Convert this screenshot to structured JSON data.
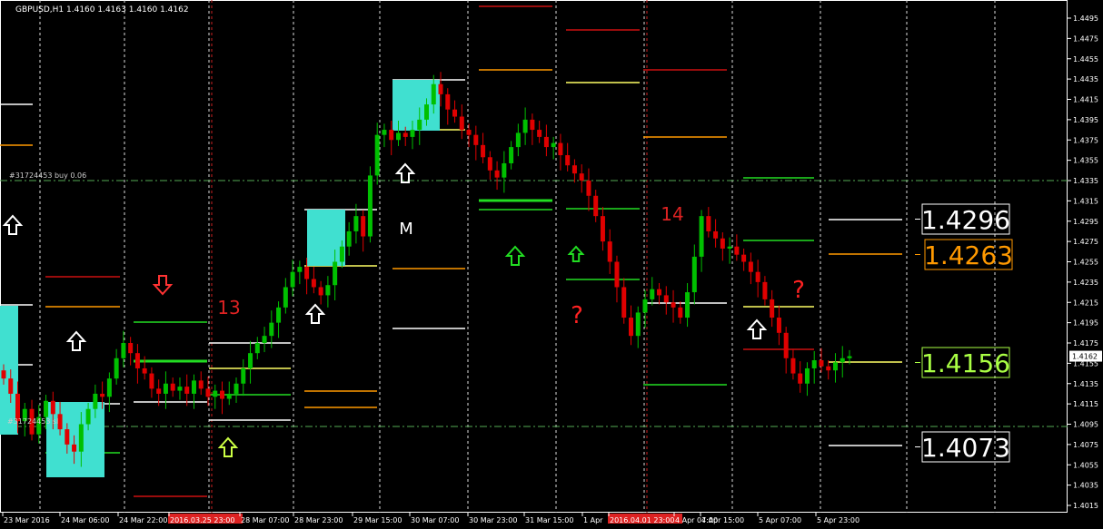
{
  "header": {
    "symbol_line": "GBPUSD,H1  1.4160 1.4163 1.4160 1.4162",
    "order_label": "#31724453 buy 0.06",
    "order_label_2": "#31724453 sl"
  },
  "colors": {
    "background": "#000000",
    "bull": "#00c000",
    "bear": "#e00000",
    "box": "#40e0d0",
    "white": "#ffffff",
    "orange": "#ff9900",
    "yellow": "#ffff66",
    "green_line": "#22dd22",
    "red_line": "#cc1111",
    "grid": "#dddddd",
    "dashdot": "#55aa55"
  },
  "chart_data": {
    "type": "candlestick",
    "symbol": "GBPUSD",
    "timeframe": "H1",
    "current_price": "1.4162",
    "ylim": [
      1.4012,
      1.4505
    ],
    "y_ticks": [
      "1.4495",
      "1.4475",
      "1.4455",
      "1.4435",
      "1.4415",
      "1.4395",
      "1.4375",
      "1.4355",
      "1.4335",
      "1.4315",
      "1.4295",
      "1.4275",
      "1.4255",
      "1.4235",
      "1.4215",
      "1.4195",
      "1.4175",
      "1.4155",
      "1.4135",
      "1.4115",
      "1.4095",
      "1.4075",
      "1.4055",
      "1.4035",
      "1.4015"
    ],
    "x_labels": [
      "23 Mar 2016",
      "24 Mar 06:00",
      "24 Mar 22:00",
      "2016.03.25 23:00",
      "28 Mar 07:00",
      "28 Mar 23:00",
      "29 Mar 15:00",
      "30 Mar 07:00",
      "30 Mar 23:00",
      "31 Mar 15:00",
      "1 Apr",
      "2016.04.01 23:00",
      "4 Apr 07:00",
      "4 Apr 15:00",
      "5 Apr 07:00",
      "5 Apr 23:00"
    ],
    "price_labels": [
      {
        "text": "1.4296",
        "color": "#ffffff"
      },
      {
        "text": "1.4263",
        "color": "#ff9900"
      },
      {
        "text": "1.4156",
        "color": "#aaff44"
      },
      {
        "text": "1.4073",
        "color": "#ffffff"
      }
    ],
    "annotations": [
      {
        "text": "13",
        "color": "#dd2222"
      },
      {
        "text": "14",
        "color": "#dd2222"
      },
      {
        "text": "M",
        "color": "#ffffff"
      },
      {
        "text": "?",
        "color": "#ff2222"
      },
      {
        "text": "?",
        "color": "#ff2222"
      }
    ],
    "closes": [
      1.414,
      1.4125,
      1.4098,
      1.411,
      1.4085,
      1.4102,
      1.4118,
      1.4105,
      1.409,
      1.4075,
      1.4068,
      1.4095,
      1.411,
      1.4125,
      1.4122,
      1.414,
      1.416,
      1.4175,
      1.4165,
      1.415,
      1.4145,
      1.413,
      1.4125,
      1.4135,
      1.4128,
      1.4132,
      1.4125,
      1.4138,
      1.413,
      1.4122,
      1.4128,
      1.412,
      1.4125,
      1.4135,
      1.415,
      1.4165,
      1.4175,
      1.4182,
      1.4195,
      1.421,
      1.423,
      1.4245,
      1.425,
      1.4238,
      1.423,
      1.4222,
      1.4232,
      1.4255,
      1.427,
      1.4285,
      1.43,
      1.428,
      1.434,
      1.438,
      1.4385,
      1.4375,
      1.4382,
      1.4378,
      1.4385,
      1.4395,
      1.441,
      1.443,
      1.442,
      1.4405,
      1.4398,
      1.4385,
      1.438,
      1.437,
      1.4358,
      1.4345,
      1.4338,
      1.4352,
      1.4368,
      1.4382,
      1.4395,
      1.4385,
      1.4378,
      1.4368,
      1.4372,
      1.436,
      1.435,
      1.4342,
      1.4335,
      1.432,
      1.43,
      1.4275,
      1.4255,
      1.423,
      1.42,
      1.4182,
      1.4205,
      1.4218,
      1.4228,
      1.4222,
      1.4215,
      1.421,
      1.42,
      1.4225,
      1.426,
      1.43,
      1.4285,
      1.4278,
      1.4268,
      1.427,
      1.4262,
      1.4255,
      1.4245,
      1.4235,
      1.4218,
      1.42,
      1.4185,
      1.416,
      1.4145,
      1.4135,
      1.415,
      1.4158,
      1.4152,
      1.4148,
      1.4156,
      1.416,
      1.4162
    ]
  }
}
